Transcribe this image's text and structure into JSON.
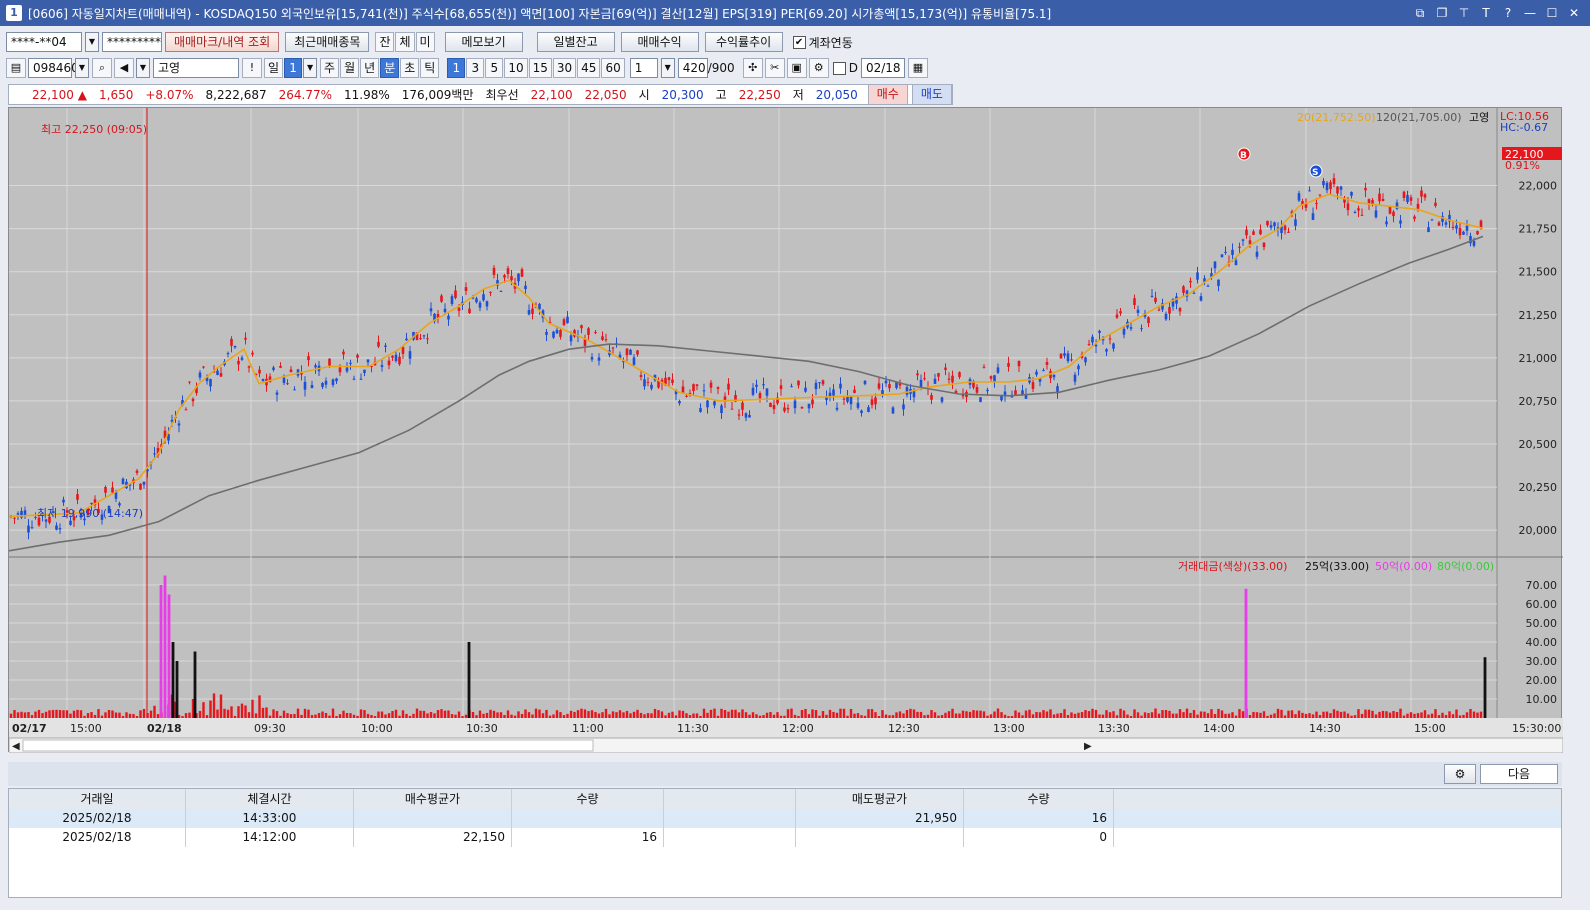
{
  "window": {
    "title": "[0606] 자동일지차트(매매내역) - KOSDAQ150 외국인보유[15,741(천)] 주식수[68,655(천)] 액면[100] 자본금[69(억)] 결산[12월] EPS[319] PER[69.20] 시가총액[15,173(억)] 유통비율[75.1]",
    "icon": "1"
  },
  "toolbar1": {
    "account": "****-**04",
    "password": "*********",
    "btn_mark": "매매마크/내역 조회",
    "btn_recent": "최근매매종목",
    "tg1": "잔",
    "tg2": "체",
    "tg3": "미",
    "btn_memo": "메모보기",
    "btn_daily": "일별잔고",
    "btn_monthly": "매매수익",
    "btn_return": "수익률추이",
    "chk_link": "계좌연동"
  },
  "toolbar2": {
    "code": "098460",
    "name": "고영",
    "periods": [
      "일",
      "1"
    ],
    "ranges": [
      "주",
      "월",
      "년",
      "분",
      "초",
      "틱"
    ],
    "minutes": [
      "1",
      "3",
      "5",
      "10",
      "15",
      "30",
      "45",
      "60"
    ],
    "count_sel": "1",
    "count": "420",
    "count_total": "/900",
    "date_label": "D",
    "date": "02/18"
  },
  "quote": {
    "price": "22,100",
    "change": "1,650",
    "change_pct": "+8.07%",
    "volume": "8,222,687",
    "vol_ratio": "264.77%",
    "turnover": "11.98%",
    "amount": "176,009백만",
    "best_label": "최우선",
    "best_ask": "22,100",
    "best_bid": "22,050",
    "open_label": "시",
    "open": "20,300",
    "high_label": "고",
    "high": "22,250",
    "low_label": "저",
    "low": "20,050",
    "buy_btn": "매수",
    "sell_btn": "매도"
  },
  "chart_data": {
    "type": "candlestick",
    "title": "",
    "legend": {
      "ma20": "20(21,752.50)",
      "ma120": "120(21,705.00)",
      "name": "고영",
      "lc": "LC:10.56",
      "hc": "HC:-0.67"
    },
    "annotations": {
      "high": "최고 22,250 (09:05)",
      "low": "최저 19,990 (14:47)",
      "current_price": "22,100",
      "current_pct": "0.91%",
      "buy_mark": "B",
      "sell_mark": "S"
    },
    "price_axis": {
      "ticks": [
        "22,000",
        "21,750",
        "21,500",
        "21,250",
        "21,000",
        "20,750",
        "20,500",
        "20,250",
        "20,000"
      ],
      "ylim": [
        19850,
        22450
      ]
    },
    "volume_legend": {
      "main": "거래대금(색상)(33.00)",
      "s1": "25억(33.00)",
      "s2": "50억(0.00)",
      "s3": "80억(0.00)"
    },
    "volume_axis": {
      "ticks": [
        "70.00",
        "60.00",
        "50.00",
        "40.00",
        "30.00",
        "20.00",
        "10.00"
      ]
    },
    "time_axis": {
      "labels": [
        "02/17",
        "15:00",
        "02/18",
        "09:30",
        "10:00",
        "10:30",
        "11:00",
        "11:30",
        "12:00",
        "12:30",
        "13:00",
        "13:30",
        "14:00",
        "14:30",
        "15:00",
        "15:30:00"
      ]
    },
    "series": [
      {
        "name": "20",
        "color": "#e8a51a",
        "points": [
          [
            0,
            20080
          ],
          [
            40,
            20090
          ],
          [
            70,
            20100
          ],
          [
            100,
            20200
          ],
          [
            130,
            20300
          ],
          [
            150,
            20450
          ],
          [
            170,
            20700
          ],
          [
            190,
            20850
          ],
          [
            210,
            20950
          ],
          [
            235,
            21050
          ],
          [
            250,
            20850
          ],
          [
            280,
            20900
          ],
          [
            320,
            20950
          ],
          [
            360,
            20950
          ],
          [
            390,
            21050
          ],
          [
            420,
            21200
          ],
          [
            450,
            21300
          ],
          [
            475,
            21400
          ],
          [
            500,
            21450
          ],
          [
            520,
            21350
          ],
          [
            540,
            21200
          ],
          [
            560,
            21150
          ],
          [
            580,
            21100
          ],
          [
            610,
            21000
          ],
          [
            640,
            20900
          ],
          [
            670,
            20800
          ],
          [
            710,
            20750
          ],
          [
            760,
            20760
          ],
          [
            800,
            20770
          ],
          [
            850,
            20780
          ],
          [
            890,
            20790
          ],
          [
            920,
            20830
          ],
          [
            960,
            20860
          ],
          [
            1000,
            20860
          ],
          [
            1030,
            20880
          ],
          [
            1060,
            20950
          ],
          [
            1090,
            21100
          ],
          [
            1120,
            21200
          ],
          [
            1150,
            21300
          ],
          [
            1180,
            21370
          ],
          [
            1210,
            21500
          ],
          [
            1240,
            21650
          ],
          [
            1270,
            21750
          ],
          [
            1290,
            21880
          ],
          [
            1320,
            21950
          ],
          [
            1350,
            21900
          ],
          [
            1380,
            21880
          ],
          [
            1410,
            21860
          ],
          [
            1440,
            21800
          ],
          [
            1474,
            21752
          ]
        ]
      },
      {
        "name": "120",
        "color": "#6e6e6e",
        "points": [
          [
            0,
            19880
          ],
          [
            50,
            19930
          ],
          [
            100,
            19970
          ],
          [
            150,
            20050
          ],
          [
            200,
            20200
          ],
          [
            250,
            20290
          ],
          [
            300,
            20370
          ],
          [
            350,
            20450
          ],
          [
            400,
            20580
          ],
          [
            450,
            20750
          ],
          [
            490,
            20900
          ],
          [
            520,
            20980
          ],
          [
            560,
            21050
          ],
          [
            600,
            21080
          ],
          [
            650,
            21070
          ],
          [
            700,
            21040
          ],
          [
            750,
            21010
          ],
          [
            800,
            20980
          ],
          [
            850,
            20920
          ],
          [
            900,
            20840
          ],
          [
            950,
            20790
          ],
          [
            1000,
            20780
          ],
          [
            1050,
            20800
          ],
          [
            1100,
            20870
          ],
          [
            1150,
            20930
          ],
          [
            1200,
            21010
          ],
          [
            1250,
            21140
          ],
          [
            1300,
            21300
          ],
          [
            1350,
            21430
          ],
          [
            1400,
            21550
          ],
          [
            1440,
            21630
          ],
          [
            1474,
            21705
          ]
        ]
      }
    ],
    "volume_series": {
      "spikes": [
        [
          152,
          70
        ],
        [
          156,
          75
        ],
        [
          160,
          65
        ],
        [
          164,
          40
        ],
        [
          168,
          30
        ],
        [
          186,
          35
        ],
        [
          460,
          40
        ],
        [
          1237,
          68
        ],
        [
          1476,
          32
        ]
      ]
    }
  },
  "bottombar": {
    "next_btn": "다음"
  },
  "table": {
    "headers": [
      "거래일",
      "체결시간",
      "매수평균가",
      "수량",
      "",
      "매도평균가",
      "수량"
    ],
    "rows": [
      [
        "2025/02/18",
        "14:33:00",
        "",
        "",
        "",
        "21,950",
        "16"
      ],
      [
        "2025/02/18",
        "14:12:00",
        "22,150",
        "16",
        "",
        "",
        "0"
      ]
    ]
  }
}
